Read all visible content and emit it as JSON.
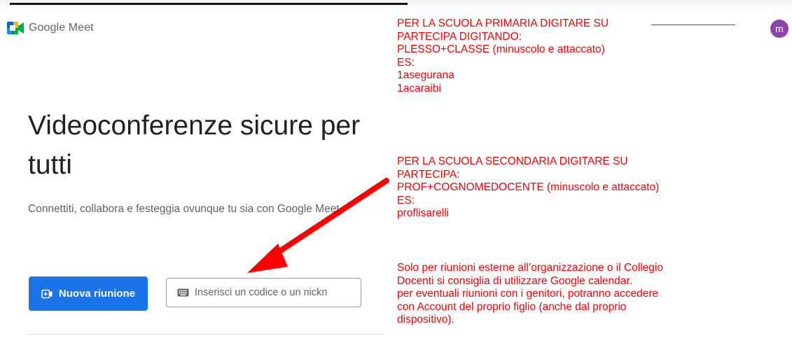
{
  "header": {
    "brand_name": "Google Meet",
    "avatar_letter": "m",
    "avatar_color": "#8e44ad"
  },
  "hero": {
    "title": "Videoconferenze sicure per tutti",
    "subtitle": "Connettiti, collabora e festeggia ovunque tu sia con Google Meet"
  },
  "actions": {
    "new_meeting_label": "Nuova riunione",
    "code_placeholder": "Inserisci un codice o un nickn"
  },
  "annotation": {
    "color": "#ff0000",
    "primaria_lines": [
      "PER LA SCUOLA PRIMARIA DIGITARE SU",
      "PARTECIPA DIGITANDO:",
      "PLESSO+CLASSE (minuscolo e attaccato)",
      "ES:",
      "1asegurana",
      "1acaraibi"
    ],
    "secondaria_lines": [
      "PER LA SCUOLA SECONDARIA DIGITARE SU",
      "PARTECIPA:",
      "PROF+COGNOMEDOCENTE (minuscolo e attaccato)",
      "ES:",
      "proflisarelli"
    ],
    "outside_lines": [
      "Solo per riunioni esterne all’organizzazione o il Collegio",
      "Docenti si consiglia di utilizzare Google calendar.",
      "per eventuali riunioni con i genitori, potranno accedere",
      "con Account del proprio figlio (anche dal proprio",
      "dispositivo)."
    ]
  },
  "icons": {
    "brand_logo": "google-meet-logo",
    "new_meeting": "video-plus-icon",
    "code_field": "keyboard-icon",
    "annotation_arrow": "red-arrow-icon"
  }
}
